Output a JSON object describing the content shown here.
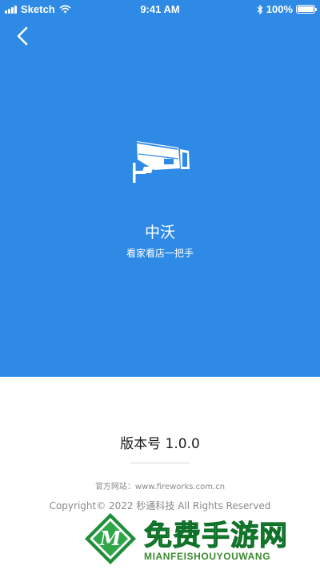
{
  "status_bar": {
    "carrier": "Sketch",
    "time": "9:41 AM",
    "battery_percent": "100%",
    "battery_level": 1.0,
    "icons": [
      "signal-icon",
      "wifi-icon",
      "bluetooth-icon",
      "battery-icon"
    ]
  },
  "header": {
    "back_icon": "chevron-left-icon"
  },
  "app": {
    "icon": "security-camera-icon",
    "name": "中沃",
    "slogan": "看家看店一把手"
  },
  "about": {
    "version": "版本号 1.0.0",
    "website": "官方网站：www.fireworks.com.cn",
    "copyright": "Copyright© 2022 秒通科技 All Rights Reserved"
  },
  "watermark": {
    "logo_letter": "M",
    "title": "免费手游网",
    "subtitle": "MIANFEISHOUYOUWANG"
  },
  "colors": {
    "hero_background": "#2f8ae5",
    "page_background": "#ffffff",
    "primary_text": "#1a1a1a",
    "secondary_text": "#8a8a8a",
    "watermark_green": "#1f9c3c"
  }
}
